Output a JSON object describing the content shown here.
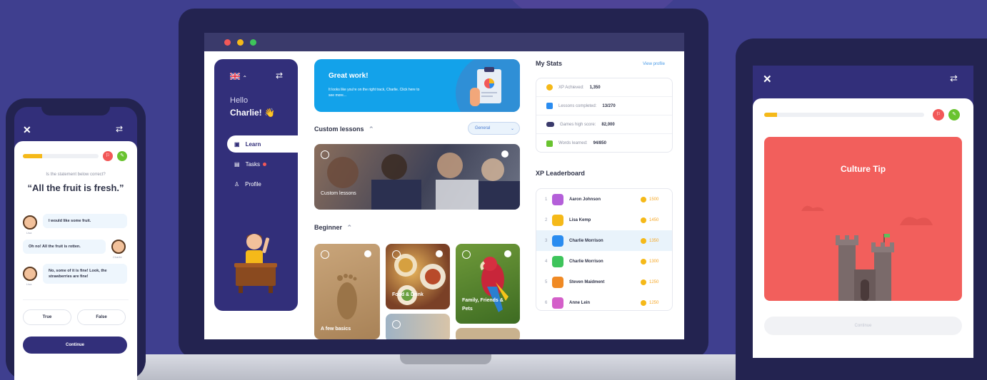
{
  "laptop": {
    "window_dots": [
      "#f25858",
      "#f5b919",
      "#3ec45b"
    ],
    "sidebar": {
      "language_icon": "uk-flag-icon",
      "greeting": "Hello",
      "user_name": "Charlie! 👋",
      "nav": [
        {
          "label": "Learn",
          "icon": "book-icon",
          "active": true
        },
        {
          "label": "Tasks",
          "icon": "tasks-icon",
          "active": false,
          "badge": true
        },
        {
          "label": "Profile",
          "icon": "user-icon",
          "active": false
        }
      ]
    },
    "banner": {
      "title": "Great work!",
      "text": "It looks like you're on the right track, Charlie. Click here to see more..."
    },
    "custom_lessons": {
      "title": "Custom lessons",
      "filter_value": "General",
      "card_label": "Custom lessons"
    },
    "beginner": {
      "title": "Beginner",
      "cards": [
        "A few basics",
        "Food & Drink",
        "Family, Friends & Pets"
      ]
    },
    "stats": {
      "title": "My Stats",
      "view_profile": "View profile",
      "rows": [
        {
          "label": "XP Achieved:",
          "value": "1,350",
          "color": "#f5b919"
        },
        {
          "label": "Lessons completed:",
          "value": "13/270",
          "color": "#2a8cf0"
        },
        {
          "label": "Games high score:",
          "value": "82,000",
          "color": "#3a3a6b"
        },
        {
          "label": "Words learned:",
          "value": "94/850",
          "color": "#69c32f"
        }
      ]
    },
    "leaderboard": {
      "title": "XP Leaderboard",
      "rows": [
        {
          "rank": "1",
          "name": "Aaron Johnson",
          "xp": "1500",
          "avatar_color": "#b45fd9",
          "highlight": false
        },
        {
          "rank": "2",
          "name": "Lisa Kemp",
          "xp": "1450",
          "avatar_color": "#f5b919",
          "highlight": false
        },
        {
          "rank": "3",
          "name": "Charlie Morrison",
          "xp": "1350",
          "avatar_color": "#2a8cf0",
          "highlight": true
        },
        {
          "rank": "4",
          "name": "Charlie Morrison",
          "xp": "1300",
          "avatar_color": "#3ec45b",
          "highlight": false
        },
        {
          "rank": "5",
          "name": "Steven Maidment",
          "xp": "1250",
          "avatar_color": "#f08a24",
          "highlight": false
        },
        {
          "rank": "6",
          "name": "Anne Lein",
          "xp": "1250",
          "avatar_color": "#d45fc9",
          "highlight": false
        }
      ]
    }
  },
  "phone": {
    "progress": 0.25,
    "question": "Is the statement below correct?",
    "statement": "“All the fruit is fresh.”",
    "messages": [
      {
        "text": "I would like some fruit.",
        "speaker": "Lisa"
      },
      {
        "text": "Oh no! All the fruit is rotten.",
        "speaker": "Charlie"
      },
      {
        "text": "No, some of it is fine! Look, the strawberries are fine!",
        "speaker": "Lisa"
      }
    ],
    "answers": [
      "True",
      "False"
    ],
    "continue": "Continue"
  },
  "tablet": {
    "progress": 0.08,
    "tip_title": "Culture Tip",
    "continue": "Continue"
  }
}
